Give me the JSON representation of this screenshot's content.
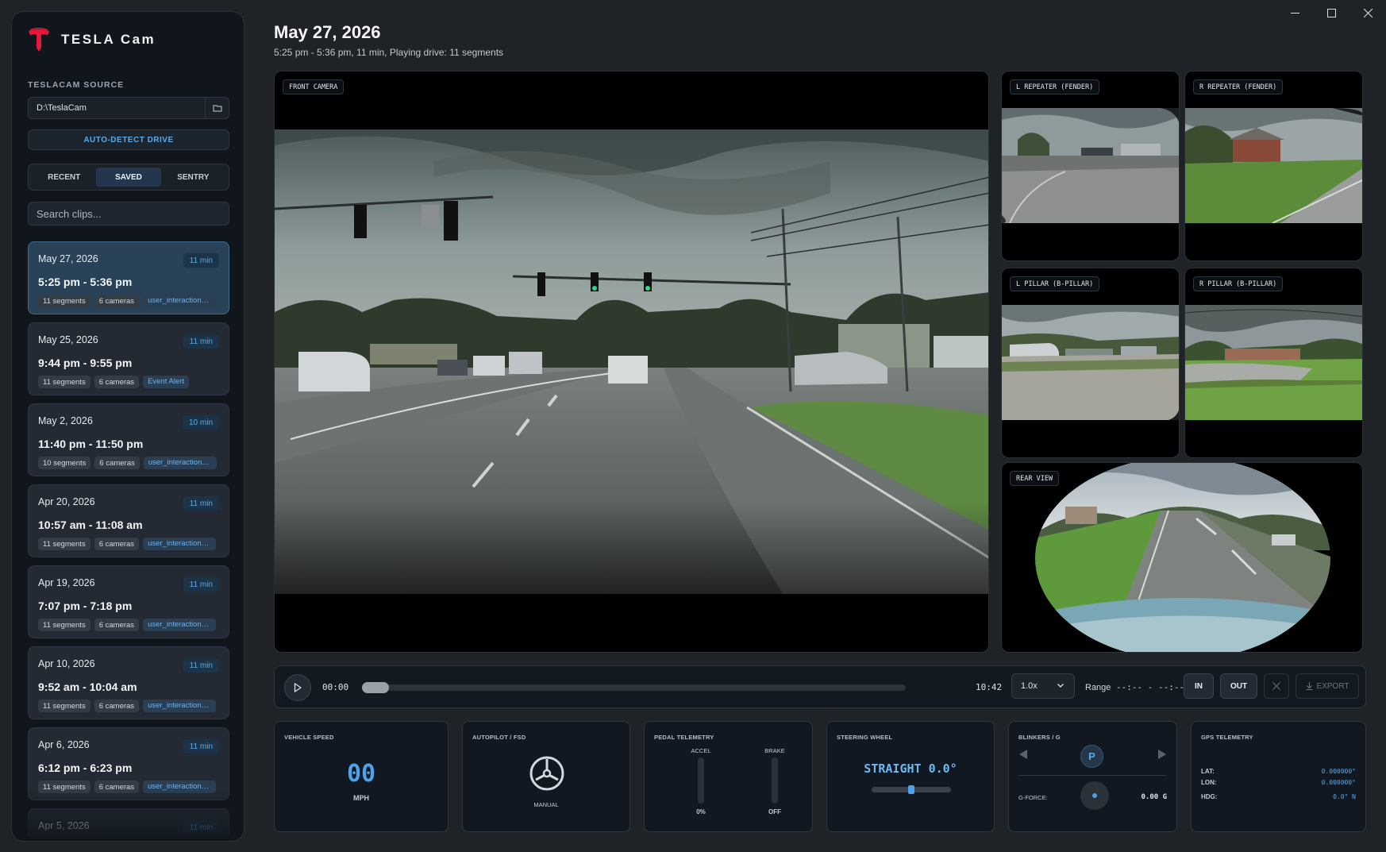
{
  "app": {
    "name": "TESLA Cam",
    "brand_color": "#e31937",
    "accent_color": "#4da3e8"
  },
  "sidebar": {
    "source_label": "TESLACAM SOURCE",
    "source_path": "D:\\TeslaCam",
    "auto_detect_label": "AUTO-DETECT DRIVE",
    "tabs": [
      {
        "label": "RECENT",
        "active": false
      },
      {
        "label": "SAVED",
        "active": true
      },
      {
        "label": "SENTRY",
        "active": false
      }
    ],
    "search_placeholder": "Search clips...",
    "clips": [
      {
        "date": "May 27, 2026",
        "duration": "11 min",
        "time": "5:25 pm - 5:36 pm",
        "segments": "11 segments",
        "cameras": "6 cameras",
        "tag": "user_interaction_d..."
      },
      {
        "date": "May 25, 2026",
        "duration": "11 min",
        "time": "9:44 pm - 9:55 pm",
        "segments": "11 segments",
        "cameras": "6 cameras",
        "tag": "Event Alert"
      },
      {
        "date": "May 2, 2026",
        "duration": "10 min",
        "time": "11:40 pm - 11:50 pm",
        "segments": "10 segments",
        "cameras": "6 cameras",
        "tag": "user_interaction_h..."
      },
      {
        "date": "Apr 20, 2026",
        "duration": "11 min",
        "time": "10:57 am - 11:08 am",
        "segments": "11 segments",
        "cameras": "6 cameras",
        "tag": "user_interaction_d..."
      },
      {
        "date": "Apr 19, 2026",
        "duration": "11 min",
        "time": "7:07 pm - 7:18 pm",
        "segments": "11 segments",
        "cameras": "6 cameras",
        "tag": "user_interaction_h..."
      },
      {
        "date": "Apr 10, 2026",
        "duration": "11 min",
        "time": "9:52 am - 10:04 am",
        "segments": "11 segments",
        "cameras": "6 cameras",
        "tag": "user_interaction_h..."
      },
      {
        "date": "Apr 6, 2026",
        "duration": "11 min",
        "time": "6:12 pm - 6:23 pm",
        "segments": "11 segments",
        "cameras": "6 cameras",
        "tag": "user_interaction_h..."
      },
      {
        "date": "Apr 5, 2026",
        "duration": "11 min",
        "time": "",
        "segments": "",
        "cameras": "",
        "tag": ""
      }
    ]
  },
  "header": {
    "title": "May 27, 2026",
    "subtitle": "5:25 pm - 5:36 pm, 11 min, Playing drive: 11 segments"
  },
  "cameras": {
    "front": "FRONT CAMERA",
    "left_repeater": "L REPEATER (FENDER)",
    "right_repeater": "R REPEATER (FENDER)",
    "left_pillar": "L PILLAR (B-PILLAR)",
    "right_pillar": "R PILLAR (B-PILLAR)",
    "rear": "REAR VIEW"
  },
  "playback": {
    "current_time": "00:00",
    "end_time": "10:42",
    "progress": 0,
    "speed": "1.0x",
    "range_label": "Range",
    "range_value": "--:-- - --:--",
    "in_label": "IN",
    "out_label": "OUT",
    "export_label": "EXPORT"
  },
  "telemetry": {
    "speed": {
      "title": "VEHICLE SPEED",
      "value": "00",
      "unit": "MPH"
    },
    "autopilot": {
      "title": "AUTOPILOT / FSD",
      "mode": "MANUAL"
    },
    "pedals": {
      "title": "PEDAL TELEMETRY",
      "accel_label": "ACCEL",
      "accel_value": "0%",
      "brake_label": "BRAKE",
      "brake_value": "OFF"
    },
    "steering": {
      "title": "STEERING WHEEL",
      "value": "STRAIGHT 0.0°",
      "position": 0.5
    },
    "blinkers": {
      "title": "BLINKERS / G",
      "gear": "P",
      "gforce_label": "G-FORCE:",
      "gforce_value": "0.00 G"
    },
    "gps": {
      "title": "GPS TELEMETRY",
      "lat_label": "LAT:",
      "lat": "0.000000°",
      "lon_label": "LON:",
      "lon": "0.000000°",
      "hdg_label": "HDG:",
      "hdg": "0.0° N"
    }
  }
}
